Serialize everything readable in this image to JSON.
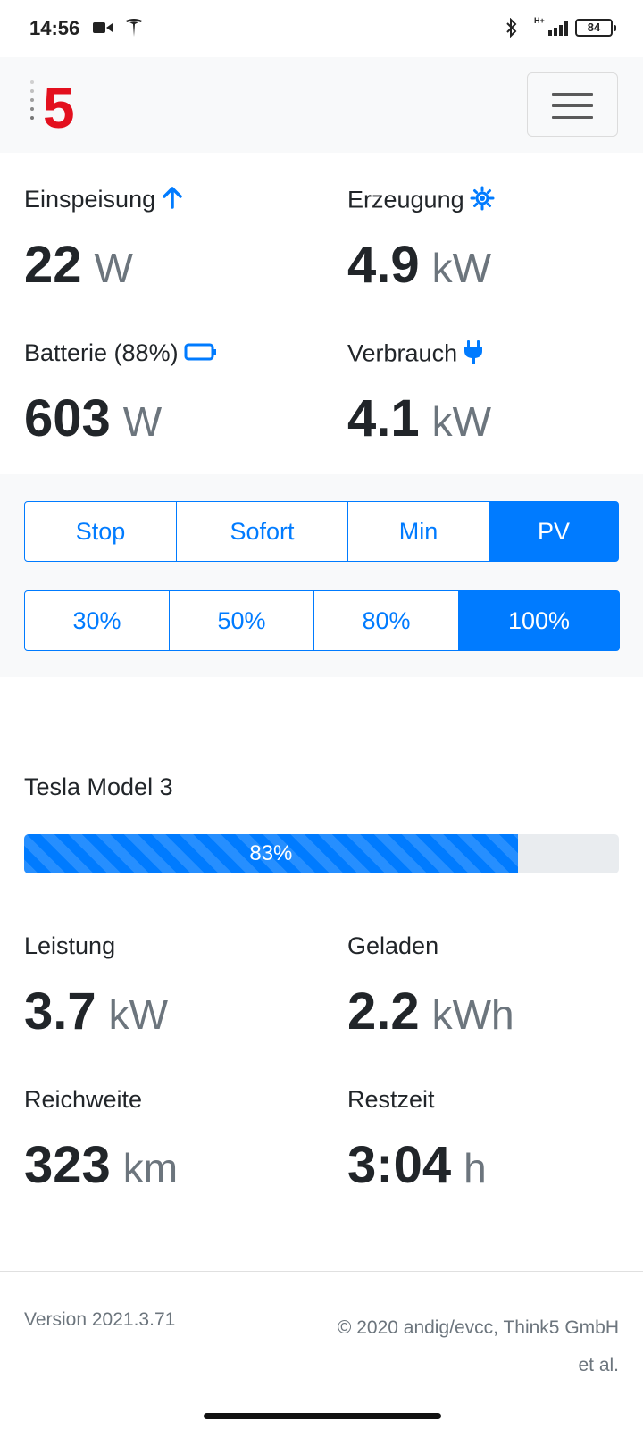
{
  "status_bar": {
    "time": "14:56",
    "network": "H+",
    "battery": "84",
    "icons": [
      "video-camera-icon",
      "tesla-icon",
      "bluetooth-icon",
      "signal-icon",
      "battery-icon"
    ]
  },
  "navbar": {
    "logo_text": "5",
    "logo_color": "#e3101e",
    "menu_icon": "hamburger-icon"
  },
  "site": {
    "feed_in": {
      "label": "Einspeisung",
      "value": "22",
      "unit": "W",
      "icon": "arrow-up-icon"
    },
    "generation": {
      "label": "Erzeugung",
      "value": "4.9",
      "unit": "kW",
      "icon": "sun-icon"
    },
    "battery": {
      "label": "Batterie (88%)",
      "value": "603",
      "unit": "W",
      "icon": "battery-outline-icon"
    },
    "consumption": {
      "label": "Verbrauch",
      "value": "4.1",
      "unit": "kW",
      "icon": "plug-icon"
    }
  },
  "modes": {
    "buttons": [
      "Stop",
      "Sofort",
      "Min",
      "PV"
    ],
    "active": "PV"
  },
  "targets": {
    "buttons": [
      "30%",
      "50%",
      "80%",
      "100%"
    ],
    "active": "100%"
  },
  "vehicle": {
    "title": "Tesla Model 3",
    "soc_label": "83%",
    "soc_fraction": 0.83,
    "power": {
      "label": "Leistung",
      "value": "3.7",
      "unit": "kW"
    },
    "charged": {
      "label": "Geladen",
      "value": "2.2",
      "unit": "kWh"
    },
    "range": {
      "label": "Reichweite",
      "value": "323",
      "unit": "km"
    },
    "remaining": {
      "label": "Restzeit",
      "value": "3:04",
      "unit": "h"
    }
  },
  "footer": {
    "version": "Version 2021.3.71",
    "copyright": "© 2020 andig/evcc, Think5 GmbH et al."
  },
  "colors": {
    "primary": "#007bff",
    "text": "#212529",
    "muted": "#6c757d",
    "panel": "#f8f9fa"
  }
}
